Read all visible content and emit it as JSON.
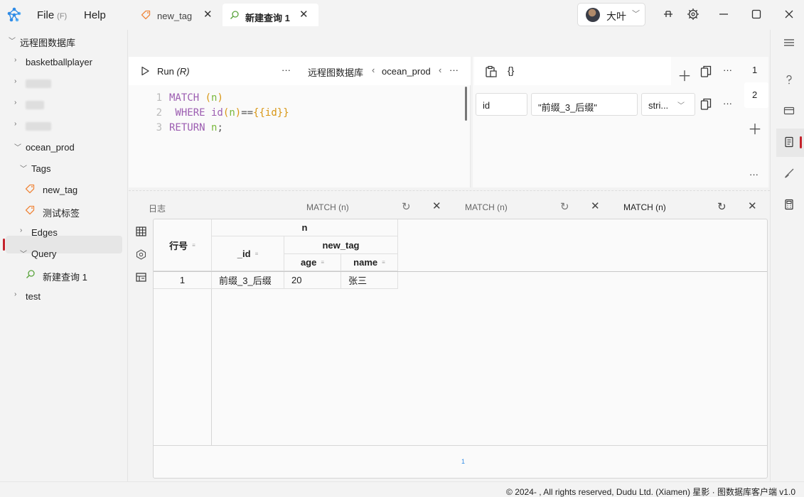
{
  "menu": {
    "file": "File",
    "file_hotkey": "(F)",
    "help": "Help"
  },
  "user": {
    "name": "大叶"
  },
  "colors": {
    "accent": "#2f8be6",
    "keyword": "#9c5db1",
    "variable": "#79b83c",
    "brace": "#d89614",
    "selected_marker": "#c4232c",
    "tag_icon": "#f0883e",
    "query_icon": "#5aa43c"
  },
  "sidebar": {
    "root": "远程图数据库",
    "items": [
      {
        "label": "basketballplayer"
      },
      {
        "label": "ocean_prod"
      },
      {
        "label": "Tags"
      },
      {
        "label": "new_tag"
      },
      {
        "label": "测试标签"
      },
      {
        "label": "Edges"
      },
      {
        "label": "Query"
      },
      {
        "label": "新建查询 1"
      },
      {
        "label": "test"
      }
    ]
  },
  "tabs": [
    {
      "label": "new_tag"
    },
    {
      "label": "新建查询 1"
    }
  ],
  "editor": {
    "run_label": "Run",
    "run_hotkey": "(R)",
    "more": "···",
    "breadcrumb_db": "远程图数据库",
    "breadcrumb_space": "ocean_prod",
    "line_numbers": [
      "1",
      "2",
      "3"
    ],
    "code": {
      "l1_kw": "MATCH",
      "l1_open": " (",
      "l1_var": "n",
      "l1_close": ")",
      "l2_kw": " WHERE",
      "l2_fn": " id",
      "l2_open": "(",
      "l2_var": "n",
      "l2_close": ")",
      "l2_eq": "==",
      "l2_param": "{{id}}",
      "l3_kw": "RETURN",
      "l3_var": " n",
      "l3_semi": ";"
    }
  },
  "params": {
    "braces_label": "{}",
    "more": "···",
    "key": "id",
    "value": "\"前缀_3_后缀\"",
    "type": "stri...",
    "pages": [
      "1",
      "2"
    ]
  },
  "results": {
    "tabs": [
      "日志",
      "MATCH (n)",
      "MATCH (n)",
      "MATCH (n)"
    ],
    "columns": {
      "row": "行号",
      "n": "n",
      "id": "_id",
      "new_tag": "new_tag",
      "age": "age",
      "name": "name"
    },
    "rows": [
      {
        "row": "1",
        "id": "前缀_3_后缀",
        "age": "20",
        "name": "张三"
      }
    ],
    "page": "1"
  },
  "footer": {
    "text": "© 2024- , All rights reserved, Dudu Ltd. (Xiamen)  星影 · 图数据库客户端  v1.0"
  }
}
